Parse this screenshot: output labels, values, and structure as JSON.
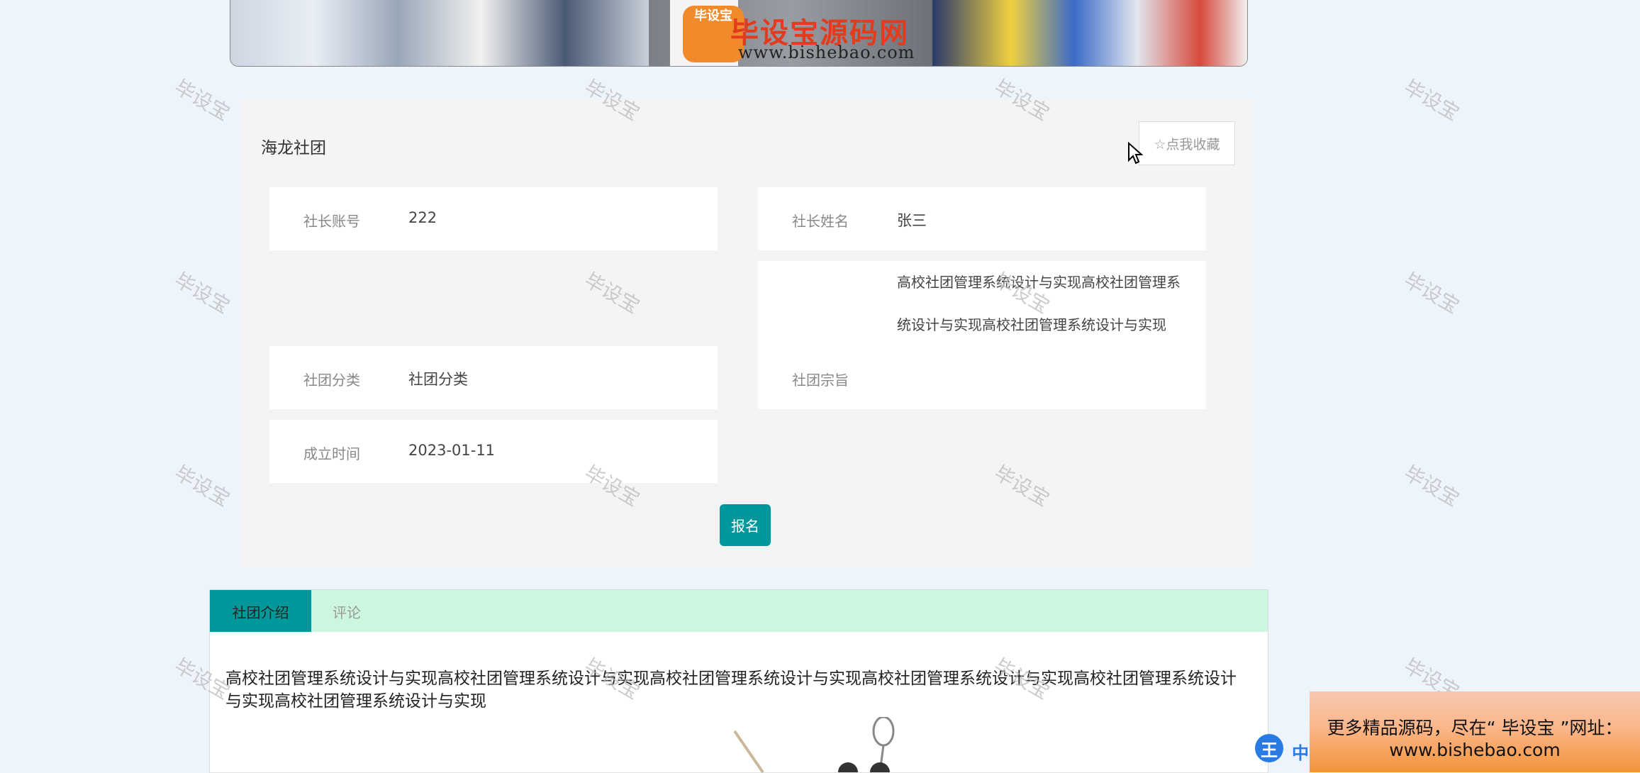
{
  "banner": {
    "logo_mark": "毕设宝",
    "logo_title": "毕设宝源码网",
    "logo_url": "www.bishebao.com"
  },
  "club": {
    "name": "海龙社团",
    "favorite_label": "☆点我收藏",
    "fields": {
      "leader_account": {
        "label": "社长账号",
        "value": "222"
      },
      "leader_name": {
        "label": "社长姓名",
        "value": "张三"
      },
      "category": {
        "label": "社团分类",
        "value": "社团分类"
      },
      "aim": {
        "label": "社团宗旨",
        "value": "高校社团管理系统设计与实现高校社团管理系统设计与实现高校社团管理系统设计与实现"
      },
      "founded": {
        "label": "成立时间",
        "value": "2023-01-11"
      }
    },
    "submit_label": "报名"
  },
  "tabs": [
    {
      "label": "社团介绍",
      "active": true
    },
    {
      "label": "评论",
      "active": false
    }
  ],
  "description": "高校社团管理系统设计与实现高校社团管理系统设计与实现高校社团管理系统设计与实现高校社团管理系统设计与实现高校社团管理系统设计与实现高校社团管理系统设计与实现",
  "watermark_text": "毕设宝",
  "ad": {
    "line1": "更多精品源码，尽在“ 毕设宝 ”网址：",
    "line2": "www.bishebao.com"
  },
  "ime": {
    "badge": "王",
    "label": "中"
  }
}
